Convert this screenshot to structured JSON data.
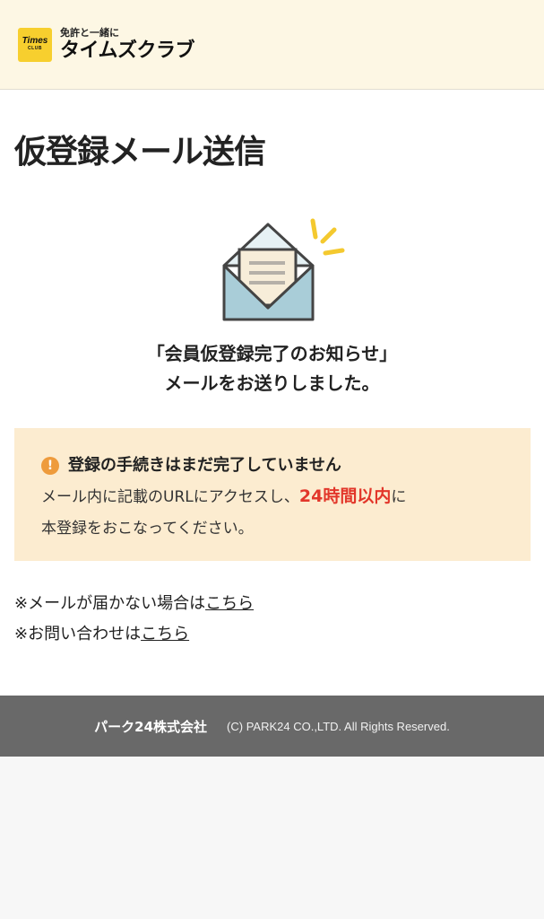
{
  "header": {
    "logo_badge_top": "Times",
    "logo_badge_bottom": "CLUB",
    "logo_subtitle": "免許と一緒に",
    "logo_title": "タイムズクラブ"
  },
  "main": {
    "page_title": "仮登録メール送信",
    "confirm_line1": "「会員仮登録完了のお知らせ」",
    "confirm_line2": "メールをお送りしました。",
    "notice": {
      "icon": "!",
      "heading": "登録の手続きはまだ完了していません",
      "body_prefix": "メール内に記載のURLにアクセスし、",
      "body_emphasis": "24時間以内",
      "body_suffix_line1": "に",
      "body_line2": "本登録をおこなってください。"
    },
    "links": {
      "mail_not_received_prefix": "※メールが届かない場合は",
      "mail_not_received_link": "こちら",
      "inquiry_prefix": "※お問い合わせは",
      "inquiry_link": "こちら"
    }
  },
  "footer": {
    "company": "パーク24株式会社",
    "copyright": "(C) PARK24 CO.,LTD. All Rights Reserved."
  },
  "colors": {
    "header_bg": "#fdf7e4",
    "logo_yellow": "#f7cf2e",
    "notice_bg": "#fcecd0",
    "warn_orange": "#ee9b3c",
    "emphasis_red": "#e2362a",
    "footer_bg": "#696969"
  }
}
